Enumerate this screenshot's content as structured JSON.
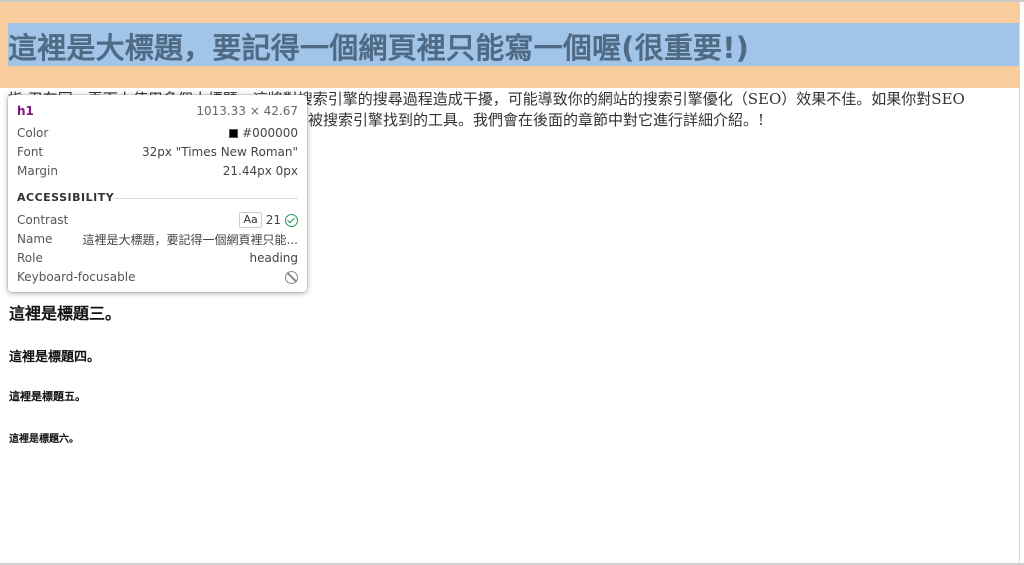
{
  "page": {
    "h1": "這裡是大標題，要記得一個網頁裡只能寫一個喔(很重要!)",
    "paragraph": "如果你對SEO有所了解，搜尋引擎優化是一種讓網頁更容易被搜索引擎找到的工具。我們會在後面的章節中對它進行詳細介紹。！",
    "paragraph_visible_line1": "指 卫车同一頁面上使用多個大標題，這將對搜索引擎的搜尋過程造成干擾，可能導致你的網站的搜索引擎優化（SEO）效果不佳。如果你對SEO",
    "paragraph_visible_line2": "有所了解，搜尋引擎優化是一種讓網頁更容易被搜索引擎找到的工具。我們會在後面的章節中對它進行詳細介紹。!",
    "h3": "這裡是標題三。",
    "h4": "這裡是標題四。",
    "h5": "這裡是標題五。",
    "h6": "這裡是標題六。"
  },
  "inspector_tooltip": {
    "tag": "h1",
    "dimensions": "1013.33 × 42.67",
    "rows": {
      "color_label": "Color",
      "color_value": "#000000",
      "font_label": "Font",
      "font_value": "32px \"Times New Roman\"",
      "margin_label": "Margin",
      "margin_value": "21.44px 0px"
    },
    "accessibility": {
      "title": "ACCESSIBILITY",
      "contrast_label": "Contrast",
      "contrast_aa": "Aa",
      "contrast_value": "21",
      "name_label": "Name",
      "name_value": "這裡是大標題，要記得一個網頁裡只能...",
      "role_label": "Role",
      "role_value": "heading",
      "keyboard_label": "Keyboard-focusable"
    }
  },
  "colors": {
    "highlight_content": "#a1c4e9",
    "highlight_margin": "#f9cc9d",
    "tag_color": "#881280",
    "check_green": "#1e9a4f"
  }
}
